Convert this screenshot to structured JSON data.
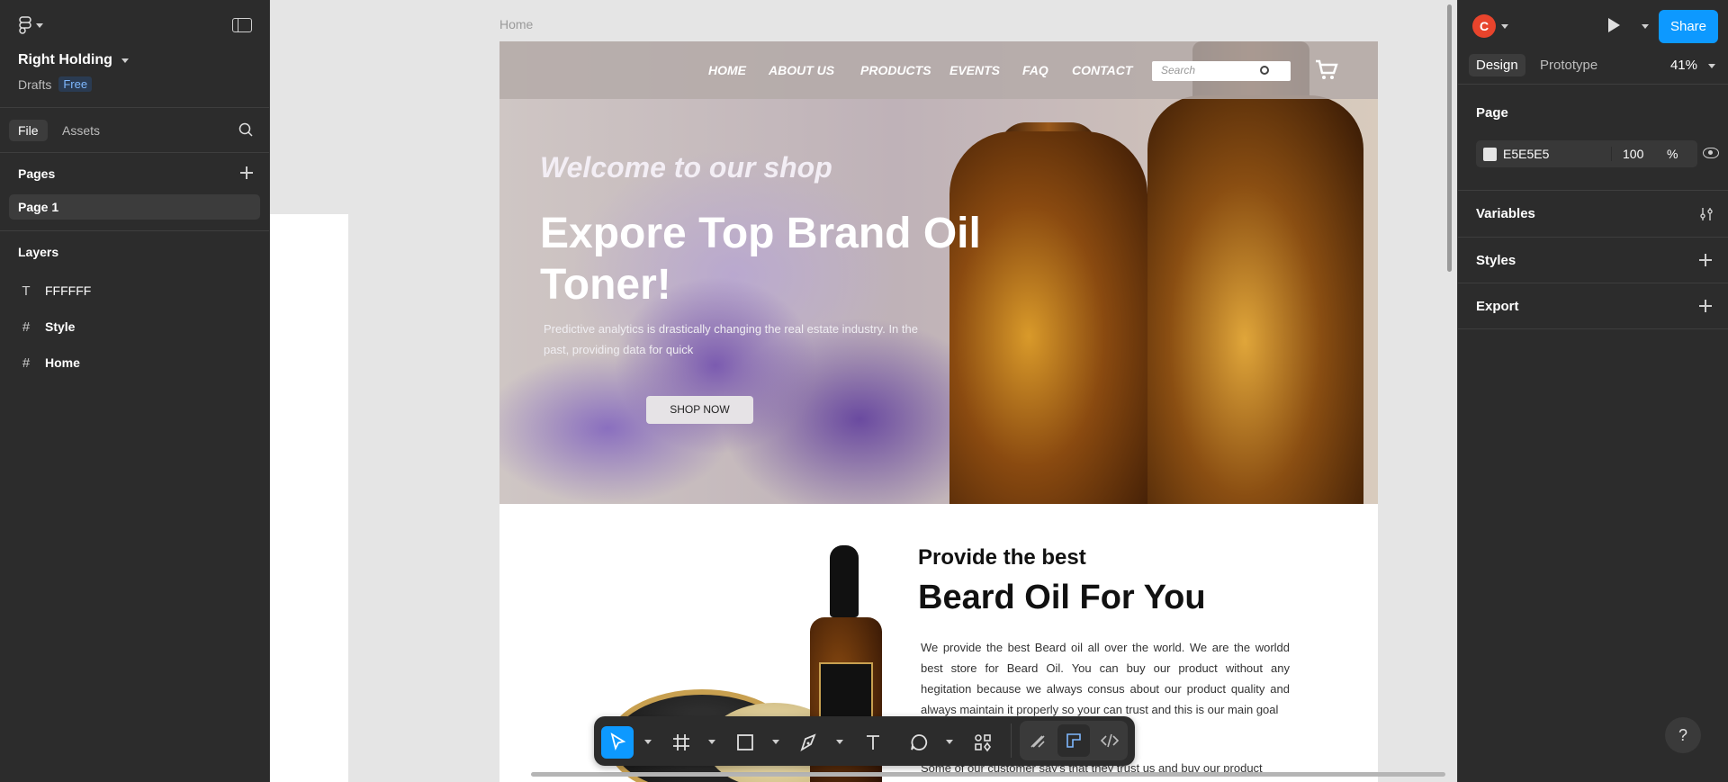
{
  "left_panel": {
    "project_name": "Right Holding",
    "drafts_label": "Drafts",
    "plan_badge": "Free",
    "tabs": [
      {
        "label": "File"
      },
      {
        "label": "Assets"
      }
    ],
    "pages_title": "Pages",
    "pages": [
      {
        "label": "Page 1"
      }
    ],
    "layers_title": "Layers",
    "layers": [
      {
        "label": "FFFFFF",
        "icon": "text-icon"
      },
      {
        "label": "Style",
        "icon": "frame-icon"
      },
      {
        "label": "Home",
        "icon": "frame-icon"
      }
    ]
  },
  "right_panel": {
    "avatar_initial": "C",
    "share_label": "Share",
    "tabs": [
      {
        "label": "Design"
      },
      {
        "label": "Prototype"
      }
    ],
    "zoom": "41%",
    "page_section": "Page",
    "page_color_hex": "E5E5E5",
    "page_opacity": "100",
    "page_opacity_unit": "%",
    "variables_label": "Variables",
    "styles_label": "Styles",
    "export_label": "Export",
    "help_label": "?"
  },
  "canvas": {
    "frame_label": "Home",
    "nav": [
      "HOME",
      "ABOUT US",
      "PRODUCTS",
      "EVENTS",
      "FAQ",
      "CONTACT"
    ],
    "search_placeholder": "Search",
    "hero": {
      "welcome": "Welcome to our shop",
      "headline": "Expore Top Brand Oil Toner!",
      "description": "Predictive analytics is drastically changing the real estate industry. In the past, providing data for quick",
      "button": "SHOP NOW"
    },
    "product_section": {
      "small_title": "Provide the best",
      "big_title": "Beard Oil For You",
      "description": "We provide the best Beard oil all over the world. We are the worldd best store for Beard Oil. You can buy our product without any hegitation because we always consus about our product quality and always maintain it properly so your can trust and this is our main goal",
      "description2": "Some of our customer say's that they trust us and buy our product"
    }
  },
  "colors": {
    "accent": "#0d99ff",
    "panel_bg": "#2c2c2c",
    "canvas_bg": "#e5e5e5",
    "avatar": "#e8442c"
  }
}
